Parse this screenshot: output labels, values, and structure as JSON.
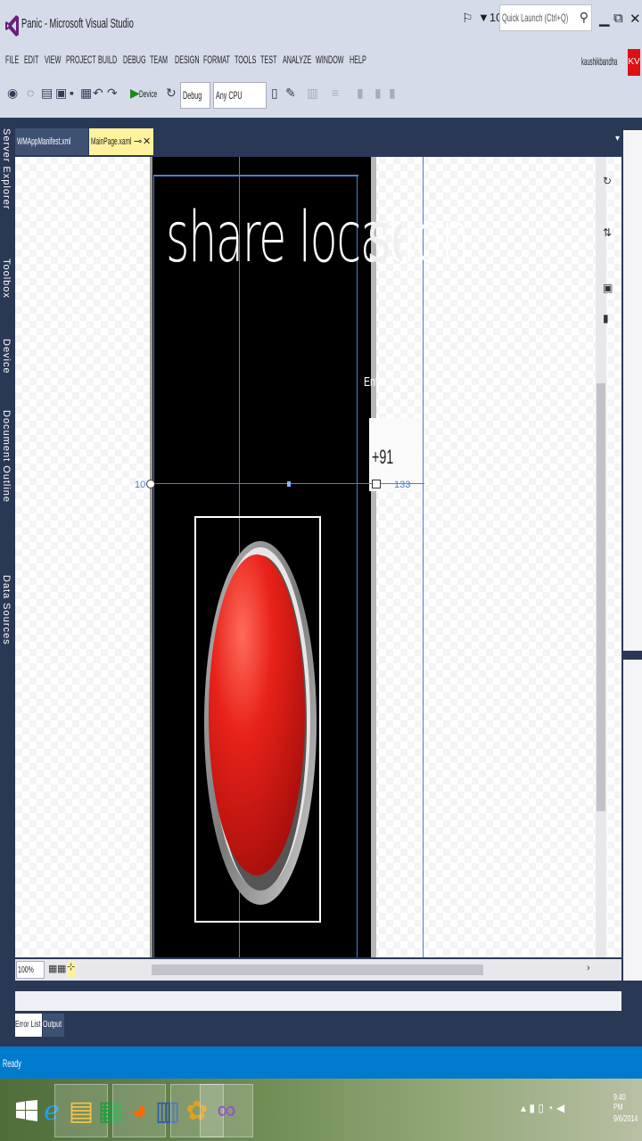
{
  "window": {
    "title": "Panic - Microsoft Visual Studio",
    "notification_count": "10",
    "quick_launch_placeholder": "Quick Launch (Ctrl+Q)",
    "user_name": "kaushikbandha",
    "user_initials": "KV"
  },
  "menu": [
    "FILE",
    "EDIT",
    "VIEW",
    "PROJECT",
    "BUILD",
    "DEBUG",
    "TEAM",
    "DESIGN",
    "FORMAT",
    "TOOLS",
    "TEST",
    "ANALYZE",
    "WINDOW",
    "HELP"
  ],
  "toolbar": {
    "run_target": "Device",
    "configuration": "Debug",
    "platform": "Any CPU"
  },
  "left_rail": [
    "Server Explorer",
    "Toolbox",
    "Device",
    "Document Outline",
    "Data Sources"
  ],
  "tabs": [
    {
      "label": "WMAppManifest.xml"
    },
    {
      "label": "MainPage.xaml"
    }
  ],
  "designer": {
    "header_text": "share location",
    "next_header_text": "setti",
    "field_label": "Enter the Phone",
    "phone_prefix": "+91",
    "margin_left": "10",
    "margin_right": "133",
    "zoom": "100%"
  },
  "bottom_tabs": [
    "Error List",
    "Output"
  ],
  "status": {
    "text": "Ready"
  },
  "taskbar": {
    "time": "9:40 PM",
    "date": "9/6/2014"
  },
  "colors": {
    "titlebar": "#d6dbe9",
    "frame": "#293955",
    "statusbar": "#007acc",
    "active_tab": "#fff29d",
    "panic_red": "#d11a1a"
  }
}
